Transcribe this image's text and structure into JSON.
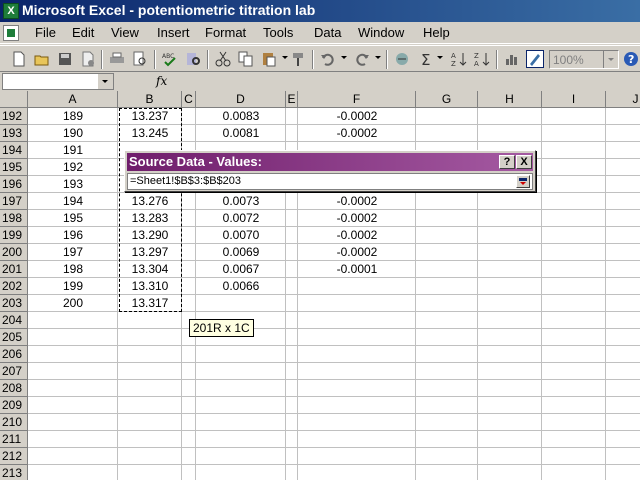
{
  "window": {
    "title": "Microsoft Excel - potentiometric titration lab",
    "app_icon": "X"
  },
  "menu": [
    "File",
    "Edit",
    "View",
    "Insert",
    "Format",
    "Tools",
    "Data",
    "Window",
    "Help"
  ],
  "toolbar": {
    "icons": [
      "new-icon",
      "open-icon",
      "save-icon",
      "permission-icon",
      "print-icon",
      "print-preview-icon",
      "spelling-icon",
      "research-icon",
      "cut-icon",
      "copy-icon",
      "paste-icon",
      "format-painter-icon",
      "undo-icon",
      "redo-icon",
      "hyperlink-icon",
      "autosum-icon",
      "sort-ascending-icon",
      "sort-descending-icon",
      "chart-wizard-icon",
      "drawing-icon"
    ],
    "zoom": "100%"
  },
  "formula_bar": {
    "name_box": "",
    "fx": "fx",
    "content": ""
  },
  "grid": {
    "columns": [
      "A",
      "B",
      "C",
      "D",
      "E",
      "F",
      "G",
      "H",
      "I",
      "J"
    ],
    "rows": [
      {
        "num": "192",
        "A": "189",
        "B": "13.237",
        "D": "0.0083",
        "F": "-0.0002"
      },
      {
        "num": "193",
        "A": "190",
        "B": "13.245",
        "D": "0.0081",
        "F": "-0.0002"
      },
      {
        "num": "194",
        "A": "191",
        "B": "",
        "D": "",
        "F": ""
      },
      {
        "num": "195",
        "A": "192",
        "B": "",
        "D": "",
        "F": ""
      },
      {
        "num": "196",
        "A": "193",
        "B": "",
        "D": "",
        "F": ""
      },
      {
        "num": "197",
        "A": "194",
        "B": "13.276",
        "D": "0.0073",
        "F": "-0.0002"
      },
      {
        "num": "198",
        "A": "195",
        "B": "13.283",
        "D": "0.0072",
        "F": "-0.0002"
      },
      {
        "num": "199",
        "A": "196",
        "B": "13.290",
        "D": "0.0070",
        "F": "-0.0002"
      },
      {
        "num": "200",
        "A": "197",
        "B": "13.297",
        "D": "0.0069",
        "F": "-0.0002"
      },
      {
        "num": "201",
        "A": "198",
        "B": "13.304",
        "D": "0.0067",
        "F": "-0.0001"
      },
      {
        "num": "202",
        "A": "199",
        "B": "13.310",
        "D": "0.0066",
        "F": ""
      },
      {
        "num": "203",
        "A": "200",
        "B": "13.317",
        "D": "",
        "F": ""
      },
      {
        "num": "204"
      },
      {
        "num": "205"
      },
      {
        "num": "206"
      },
      {
        "num": "207"
      },
      {
        "num": "208"
      },
      {
        "num": "209"
      },
      {
        "num": "210"
      },
      {
        "num": "211"
      },
      {
        "num": "212"
      },
      {
        "num": "213"
      }
    ]
  },
  "tooltip": "201R x 1C",
  "dialog": {
    "title": "Source Data - Values:",
    "help_label": "?",
    "close_label": "X",
    "value": "=Sheet1!$B$3:$B$203"
  },
  "colors": {
    "title_bar": "#0a246a",
    "dialog_title": "#6f1d6b",
    "tooltip_bg": "#ffffe1",
    "chrome": "#d4d0c8"
  }
}
